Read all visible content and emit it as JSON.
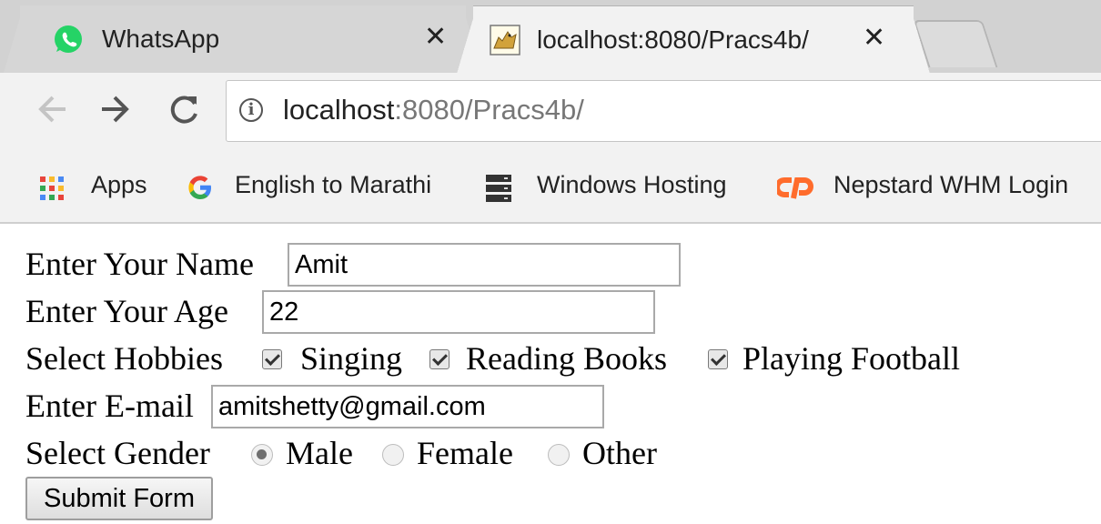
{
  "tabs": [
    {
      "title": "WhatsApp",
      "icon": "whatsapp-icon",
      "active": false
    },
    {
      "title": "localhost:8080/Pracs4b/",
      "icon": "tomcat-icon",
      "active": true
    }
  ],
  "close_glyph": "✕",
  "address": {
    "host": "localhost",
    "path": ":8080/Pracs4b/"
  },
  "bookmarks": [
    {
      "label": "Apps",
      "icon": "apps-grid-icon"
    },
    {
      "label": "English to Marathi",
      "icon": "google-icon"
    },
    {
      "label": "Windows Hosting",
      "icon": "server-icon"
    },
    {
      "label": "Nepstard WHM Login",
      "icon": "cpanel-icon"
    }
  ],
  "form": {
    "name_label": "Enter Your Name",
    "name_value": "Amit",
    "age_label": "Enter Your Age",
    "age_value": "22",
    "hobbies_label": "Select Hobbies",
    "hobbies": [
      {
        "label": "Singing",
        "checked": true
      },
      {
        "label": "Reading Books",
        "checked": true
      },
      {
        "label": "Playing Football",
        "checked": true
      }
    ],
    "email_label": "Enter E-mail",
    "email_value": "amitshetty@gmail.com",
    "gender_label": "Select Gender",
    "genders": [
      {
        "label": "Male",
        "checked": true
      },
      {
        "label": "Female",
        "checked": false
      },
      {
        "label": "Other",
        "checked": false
      }
    ],
    "submit_label": "Submit Form"
  },
  "colors": {
    "whatsapp": "#25d366",
    "cpanel": "#ff6c2c",
    "tabstrip": "#d2d2d2",
    "toolbar": "#f2f2f2"
  }
}
